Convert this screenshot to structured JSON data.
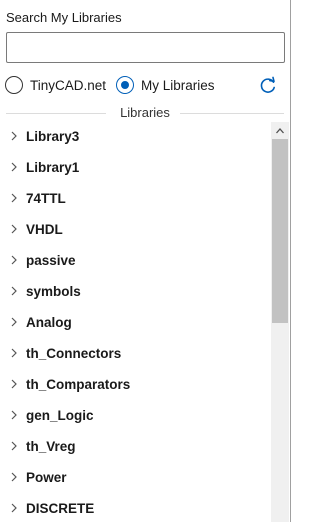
{
  "search": {
    "label": "Search My Libraries",
    "value": "",
    "placeholder": ""
  },
  "source": {
    "options": [
      {
        "label": "TinyCAD.net",
        "selected": false
      },
      {
        "label": "My Libraries",
        "selected": true
      }
    ],
    "refresh_icon": "refresh-icon"
  },
  "libraries": {
    "header": "Libraries",
    "items": [
      {
        "label": "Library3"
      },
      {
        "label": "Library1"
      },
      {
        "label": "74TTL"
      },
      {
        "label": "VHDL"
      },
      {
        "label": "passive"
      },
      {
        "label": "symbols"
      },
      {
        "label": "Analog"
      },
      {
        "label": "th_Connectors"
      },
      {
        "label": "th_Comparators"
      },
      {
        "label": "gen_Logic"
      },
      {
        "label": "th_Vreg"
      },
      {
        "label": "Power"
      },
      {
        "label": "DISCRETE"
      }
    ],
    "expand_icon": "chevron-right-icon"
  },
  "colors": {
    "accent": "#005fb8",
    "scroll_thumb": "#c2c2c2",
    "scroll_track": "#f0f0f0"
  }
}
